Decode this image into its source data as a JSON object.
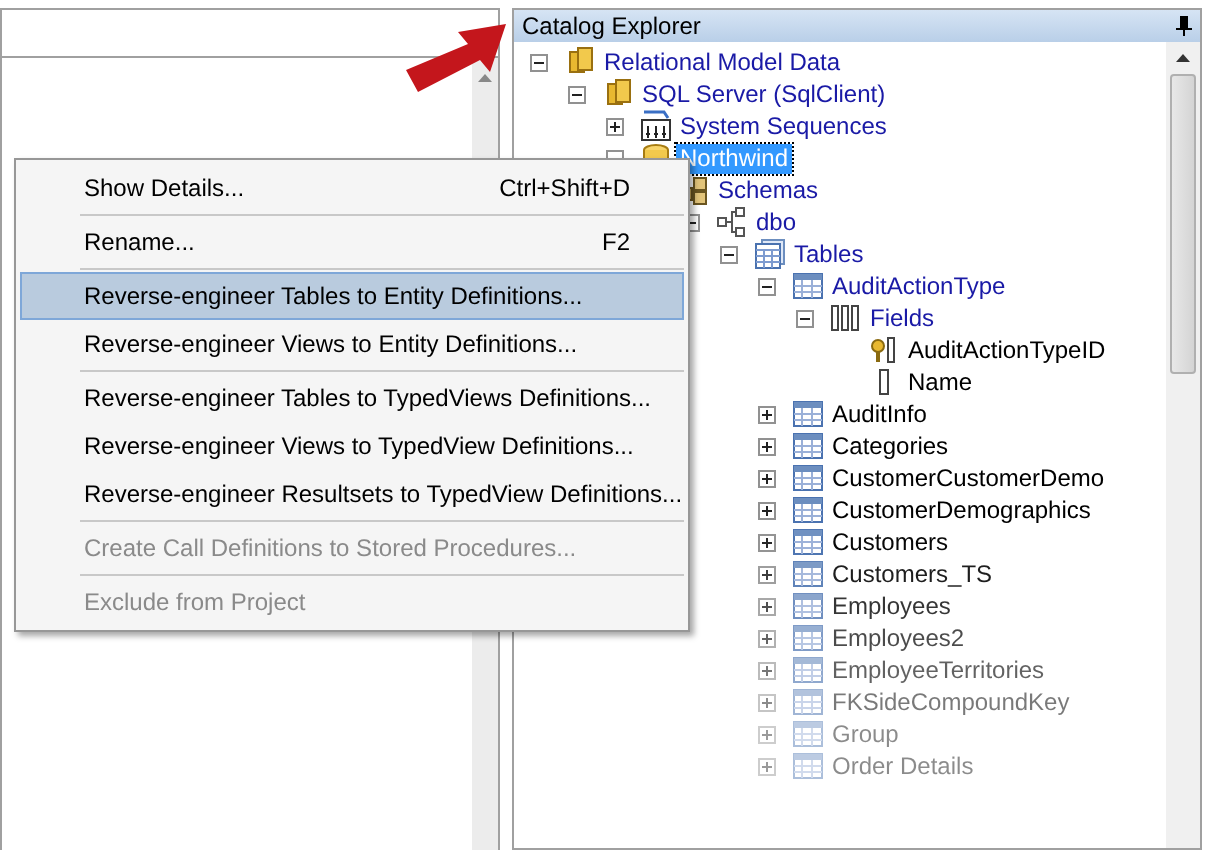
{
  "catalog_explorer": {
    "title": "Catalog Explorer",
    "tree": [
      {
        "label": "Relational Model Data",
        "kind": "database-group",
        "expanded": true,
        "selected": false,
        "children": [
          {
            "label": "SQL Server (SqlClient)",
            "kind": "database-group",
            "expanded": true,
            "selected": false,
            "children": [
              {
                "label": "System Sequences",
                "kind": "sequences",
                "expanded": false,
                "selected": false
              },
              {
                "label": "Northwind",
                "kind": "database",
                "expanded": true,
                "selected": true,
                "children": [
                  {
                    "label": "Schemas",
                    "kind": "schemas",
                    "selected": false,
                    "children": [
                      {
                        "label": "dbo",
                        "kind": "schema",
                        "expanded": true,
                        "selected": false,
                        "children": [
                          {
                            "label": "Tables",
                            "kind": "tables",
                            "expanded": true,
                            "selected": false,
                            "children": [
                              {
                                "label": "AuditActionType",
                                "kind": "table",
                                "expanded": true,
                                "selected": false,
                                "children": [
                                  {
                                    "label": "Fields",
                                    "kind": "fields",
                                    "expanded": true,
                                    "selected": false,
                                    "children": [
                                      {
                                        "label": "AuditActionTypeID",
                                        "kind": "key-field",
                                        "selected": false
                                      },
                                      {
                                        "label": "Name",
                                        "kind": "field",
                                        "selected": false
                                      }
                                    ]
                                  }
                                ]
                              },
                              {
                                "label": "AuditInfo",
                                "kind": "table",
                                "expanded": false,
                                "selected": false
                              },
                              {
                                "label": "Categories",
                                "kind": "table",
                                "expanded": false,
                                "selected": false
                              },
                              {
                                "label": "CustomerCustomerDemo",
                                "kind": "table",
                                "expanded": false,
                                "selected": false
                              },
                              {
                                "label": "CustomerDemographics",
                                "kind": "table",
                                "expanded": false,
                                "selected": false
                              },
                              {
                                "label": "Customers",
                                "kind": "table",
                                "expanded": false,
                                "selected": false
                              },
                              {
                                "label": "Customers_TS",
                                "kind": "table",
                                "expanded": false,
                                "selected": false
                              },
                              {
                                "label": "Employees",
                                "kind": "table",
                                "expanded": false,
                                "selected": false
                              },
                              {
                                "label": "Employees2",
                                "kind": "table",
                                "expanded": false,
                                "selected": false
                              },
                              {
                                "label": "EmployeeTerritories",
                                "kind": "table",
                                "expanded": false,
                                "selected": false
                              },
                              {
                                "label": "FKSideCompoundKey",
                                "kind": "table",
                                "expanded": false,
                                "selected": false
                              },
                              {
                                "label": "Group",
                                "kind": "table",
                                "expanded": false,
                                "selected": false
                              },
                              {
                                "label": "Order Details",
                                "kind": "table",
                                "expanded": false,
                                "selected": false
                              }
                            ]
                          }
                        ]
                      }
                    ]
                  }
                ]
              }
            ]
          }
        ]
      }
    ]
  },
  "context_menu": [
    {
      "label": "Show Details...",
      "shortcut": "Ctrl+Shift+D",
      "selected": false,
      "disabled": false,
      "separator_after": true
    },
    {
      "label": "Rename...",
      "shortcut": "F2",
      "selected": false,
      "disabled": false,
      "separator_after": true
    },
    {
      "label": "Reverse-engineer Tables to Entity Definitions...",
      "selected": true,
      "disabled": false,
      "separator_after": false
    },
    {
      "label": "Reverse-engineer Views to Entity Definitions...",
      "selected": false,
      "disabled": false,
      "separator_after": true
    },
    {
      "label": "Reverse-engineer Tables to TypedViews Definitions...",
      "selected": false,
      "disabled": false,
      "separator_after": false
    },
    {
      "label": "Reverse-engineer Views to TypedView Definitions...",
      "selected": false,
      "disabled": false,
      "separator_after": false
    },
    {
      "label": "Reverse-engineer Resultsets to TypedView Definitions...",
      "selected": false,
      "disabled": false,
      "separator_after": true
    },
    {
      "label": "Create Call Definitions to Stored Procedures...",
      "selected": false,
      "disabled": true,
      "separator_after": true
    },
    {
      "label": "Exclude from Project",
      "selected": false,
      "disabled": true,
      "separator_after": false
    }
  ]
}
